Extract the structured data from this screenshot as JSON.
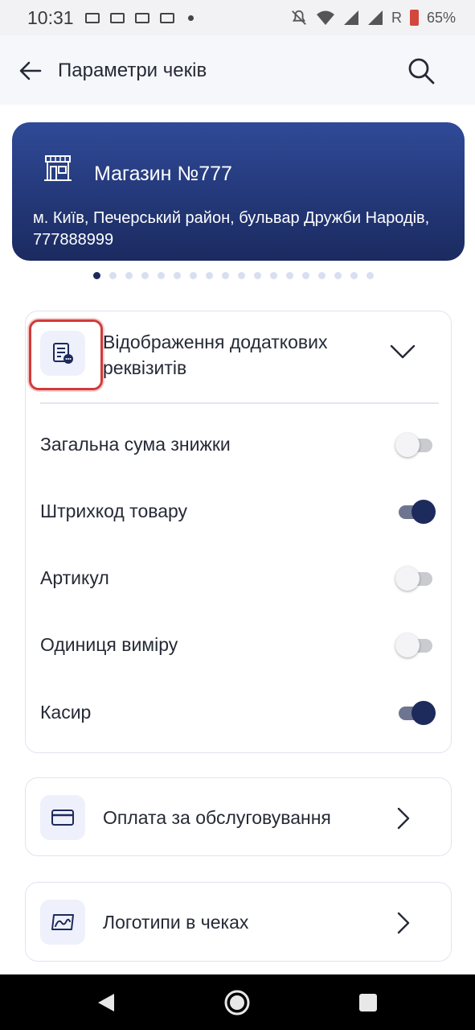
{
  "status_bar": {
    "time": "10:31",
    "network": "R",
    "battery": "65%"
  },
  "app_bar": {
    "title": "Параметри чеків"
  },
  "store_card": {
    "name": "Магазин №777",
    "address": "м. Київ, Печерський район, бульвар Дружби Народів, 777888999",
    "pager_total": 18,
    "pager_active": 1
  },
  "section": {
    "title": "Відображення додаткових реквізитів",
    "toggles": [
      {
        "label": "Загальна сума знижки",
        "on": false
      },
      {
        "label": "Штрихкод товару",
        "on": true
      },
      {
        "label": "Артикул",
        "on": false
      },
      {
        "label": "Одиниця виміру",
        "on": false
      },
      {
        "label": "Касир",
        "on": true
      }
    ]
  },
  "nav_items": [
    {
      "label": "Оплата за обслуговування",
      "icon": "card-icon"
    },
    {
      "label": "Логотипи в чеках",
      "icon": "logo-image-icon"
    }
  ],
  "colors": {
    "accent": "#1d2a5c",
    "card_gradient_top": "#2f4a97",
    "card_gradient_bottom": "#1b2a60",
    "highlight": "#d23a3a"
  }
}
